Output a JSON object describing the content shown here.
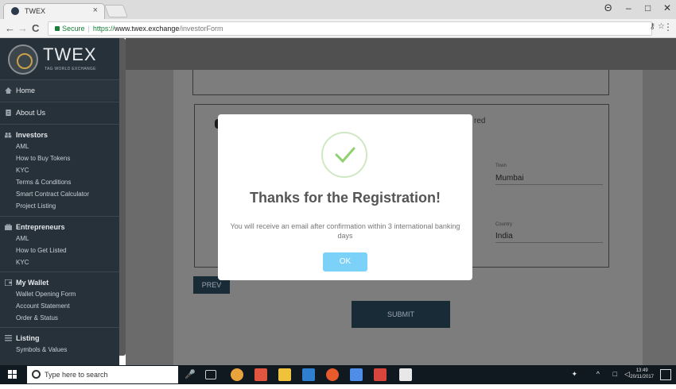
{
  "browser": {
    "tab_title": "TWEX",
    "tab_close": "×",
    "window_controls": {
      "user": "Θ",
      "minimize": "–",
      "restore": "□",
      "close": "✕"
    },
    "nav": {
      "back": "←",
      "forward": "→",
      "reload": "C"
    },
    "address": {
      "secure_label": "Secure",
      "scheme": "https://",
      "host": "www.twex.exchange",
      "path": "/investorForm"
    },
    "omnibox_icons": {
      "key": "⚷",
      "star": "☆"
    },
    "menu": "⋮"
  },
  "sidebar": {
    "logo": {
      "title": "TWEX",
      "subtitle": "TAG WORLD EXCHANGE"
    },
    "home": "Home",
    "about": "About Us",
    "investors": {
      "label": "Investors",
      "items": [
        "AML",
        "How to Buy Tokens",
        "KYC",
        "Terms & Conditions",
        "Smart Contract Calculator",
        "Project Listing"
      ]
    },
    "entrepreneurs": {
      "label": "Entrepreneurs",
      "items": [
        "AML",
        "How to Get Listed",
        "KYC"
      ]
    },
    "wallet": {
      "label": "My Wallet",
      "items": [
        "Wallet Opening Form",
        "Account Statement",
        "Order & Status"
      ]
    },
    "listing": {
      "label": "Listing",
      "items": [
        "Symbols & Values"
      ]
    }
  },
  "form": {
    "partial_text": "red",
    "town": {
      "label": "Town",
      "value": "Mumbai"
    },
    "country": {
      "label": "Country",
      "value": "India"
    },
    "prev_label": "PREV",
    "submit_label": "SUBMIT"
  },
  "modal": {
    "title": "Thanks for the Registration!",
    "message": "You will receive an email after confirmation within 3 international banking days",
    "ok_label": "OK",
    "icon": "checkmark-icon",
    "check_color": "#8fd16e"
  },
  "taskbar": {
    "search_placeholder": "Type here to search",
    "time": "13:49",
    "date": "20/11/2017"
  }
}
